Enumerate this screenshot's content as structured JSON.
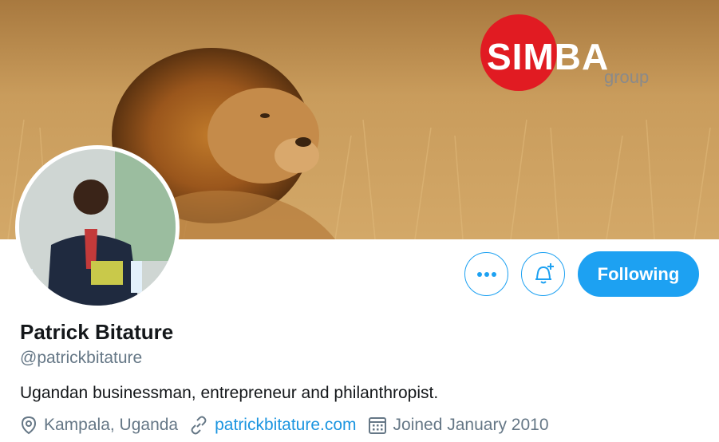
{
  "banner": {
    "brand_name": "SIMBA",
    "brand_sub": "group",
    "colors": {
      "brand_red": "#e11b22",
      "grass": "#c79a58"
    }
  },
  "profile": {
    "name": "Patrick Bitature",
    "handle": "@patrickbitature",
    "bio": "Ugandan businessman, entrepreneur and philanthropist.",
    "location": "Kampala, Uganda",
    "website": "patrickbitature.com",
    "joined": "Joined January 2010"
  },
  "actions": {
    "more_icon": "more-icon",
    "notify_icon": "bell-plus-icon",
    "follow_label": "Following",
    "accent": "#1da1f2"
  }
}
